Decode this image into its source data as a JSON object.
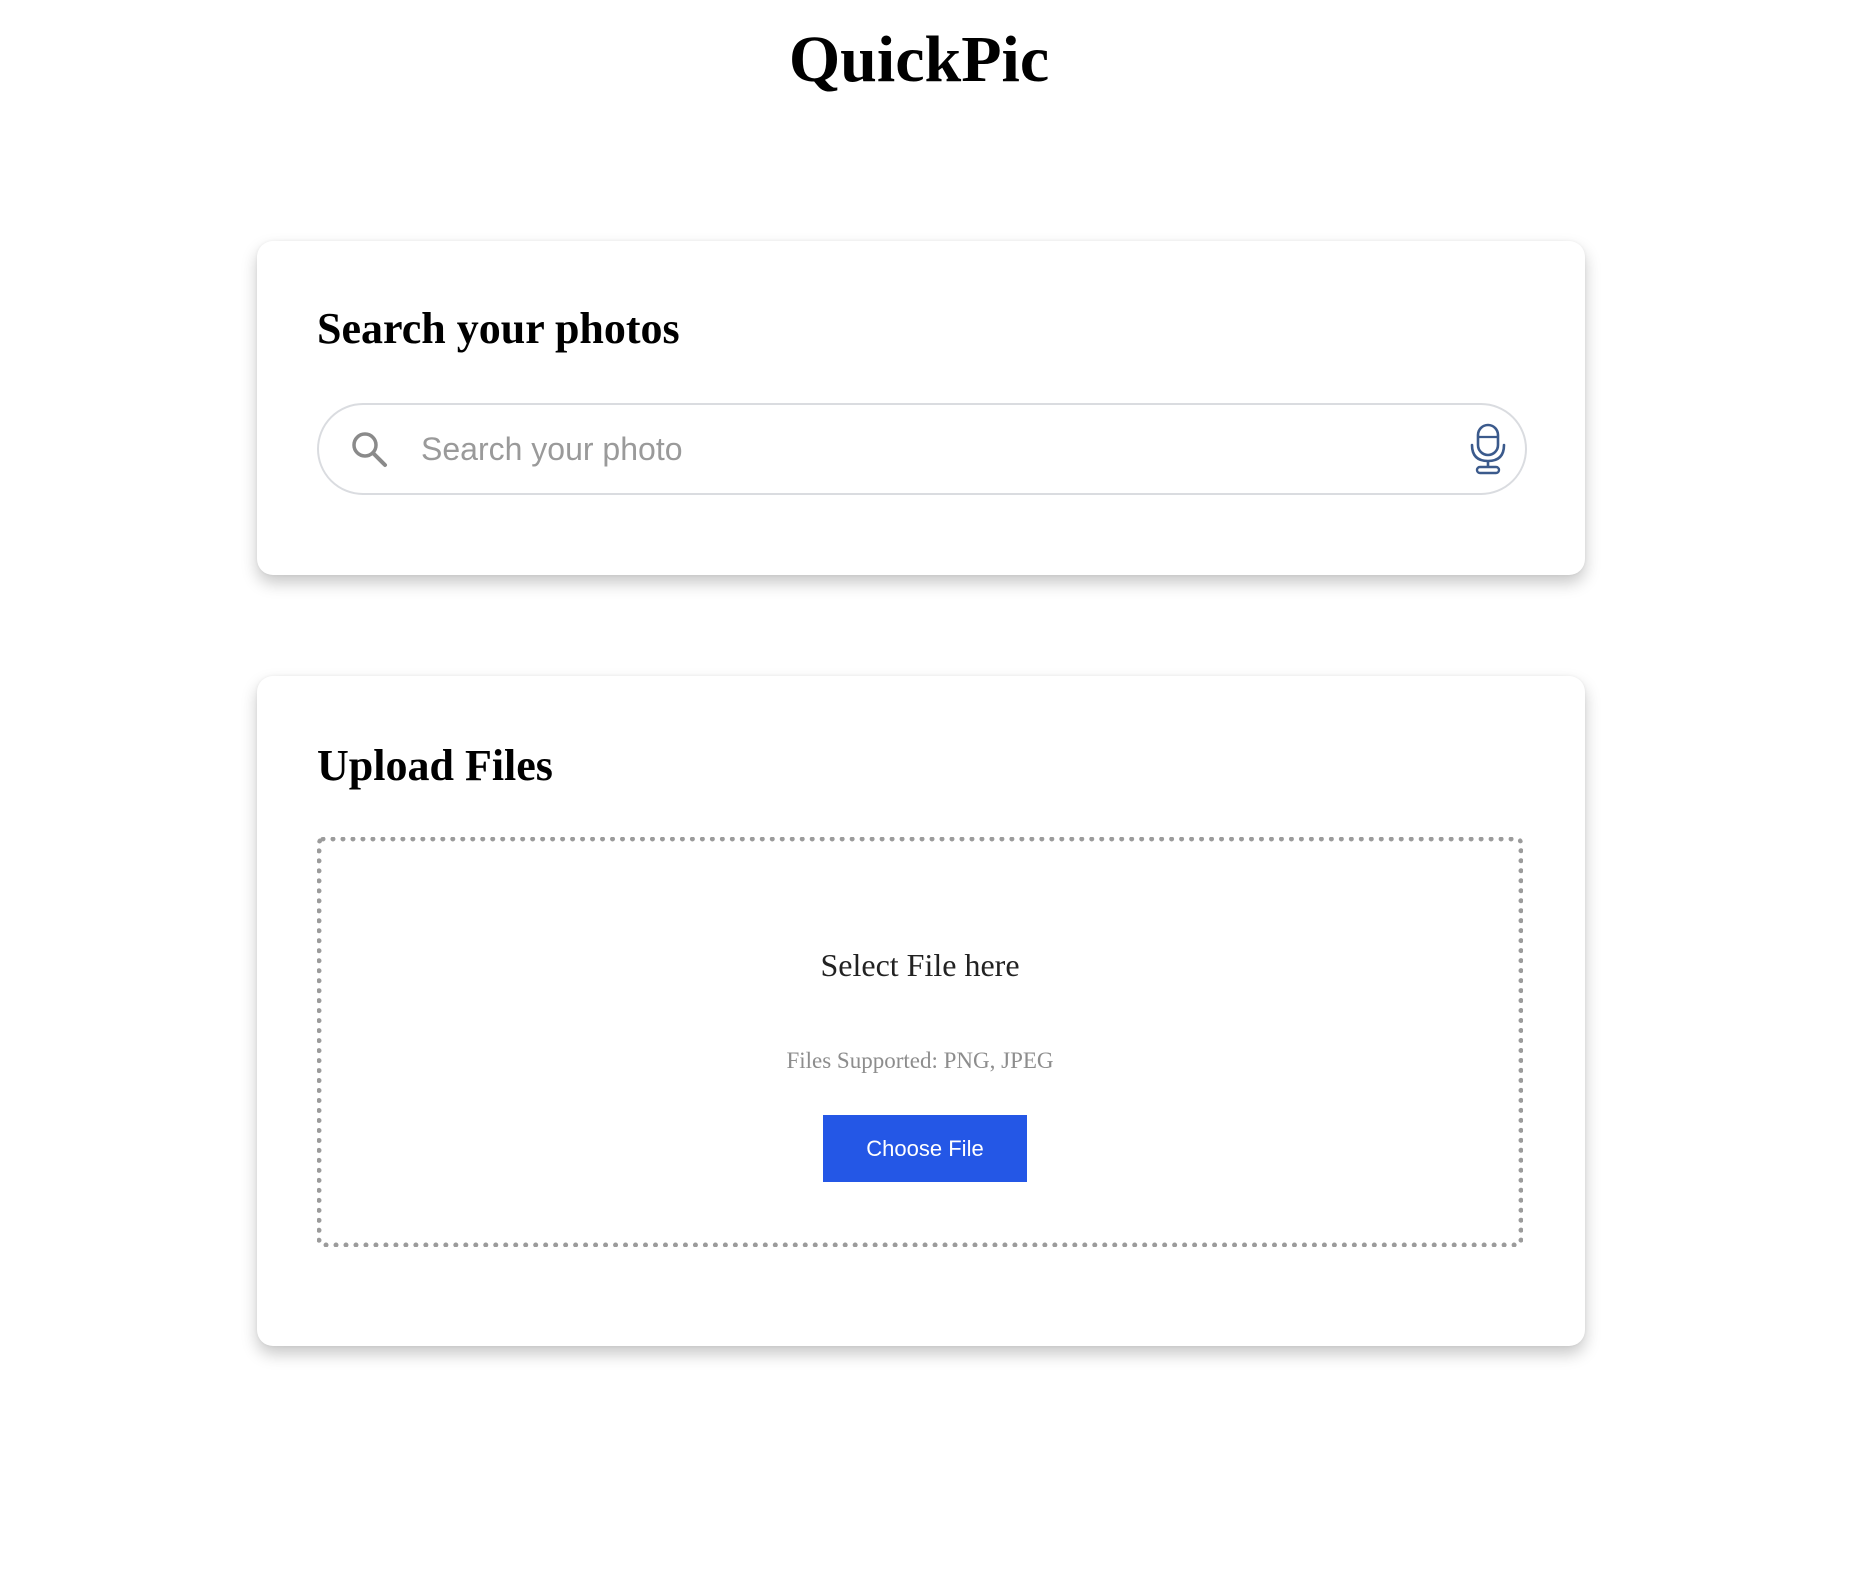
{
  "app": {
    "title": "QuickPic"
  },
  "search_card": {
    "heading": "Search your photos",
    "search": {
      "value": "",
      "placeholder": "Search your photo"
    },
    "icons": {
      "search": "search-icon",
      "mic": "microphone-icon"
    },
    "colors": {
      "mic": "#3b5a8c",
      "search_icon": "#8a8a8a"
    }
  },
  "upload_card": {
    "heading": "Upload Files",
    "drop_title": "Select File here",
    "supported_text": "Files Supported: PNG, JPEG",
    "choose_button": "Choose File",
    "colors": {
      "button": "#2457e6",
      "dropzone_border": "#9b9b9b"
    }
  }
}
